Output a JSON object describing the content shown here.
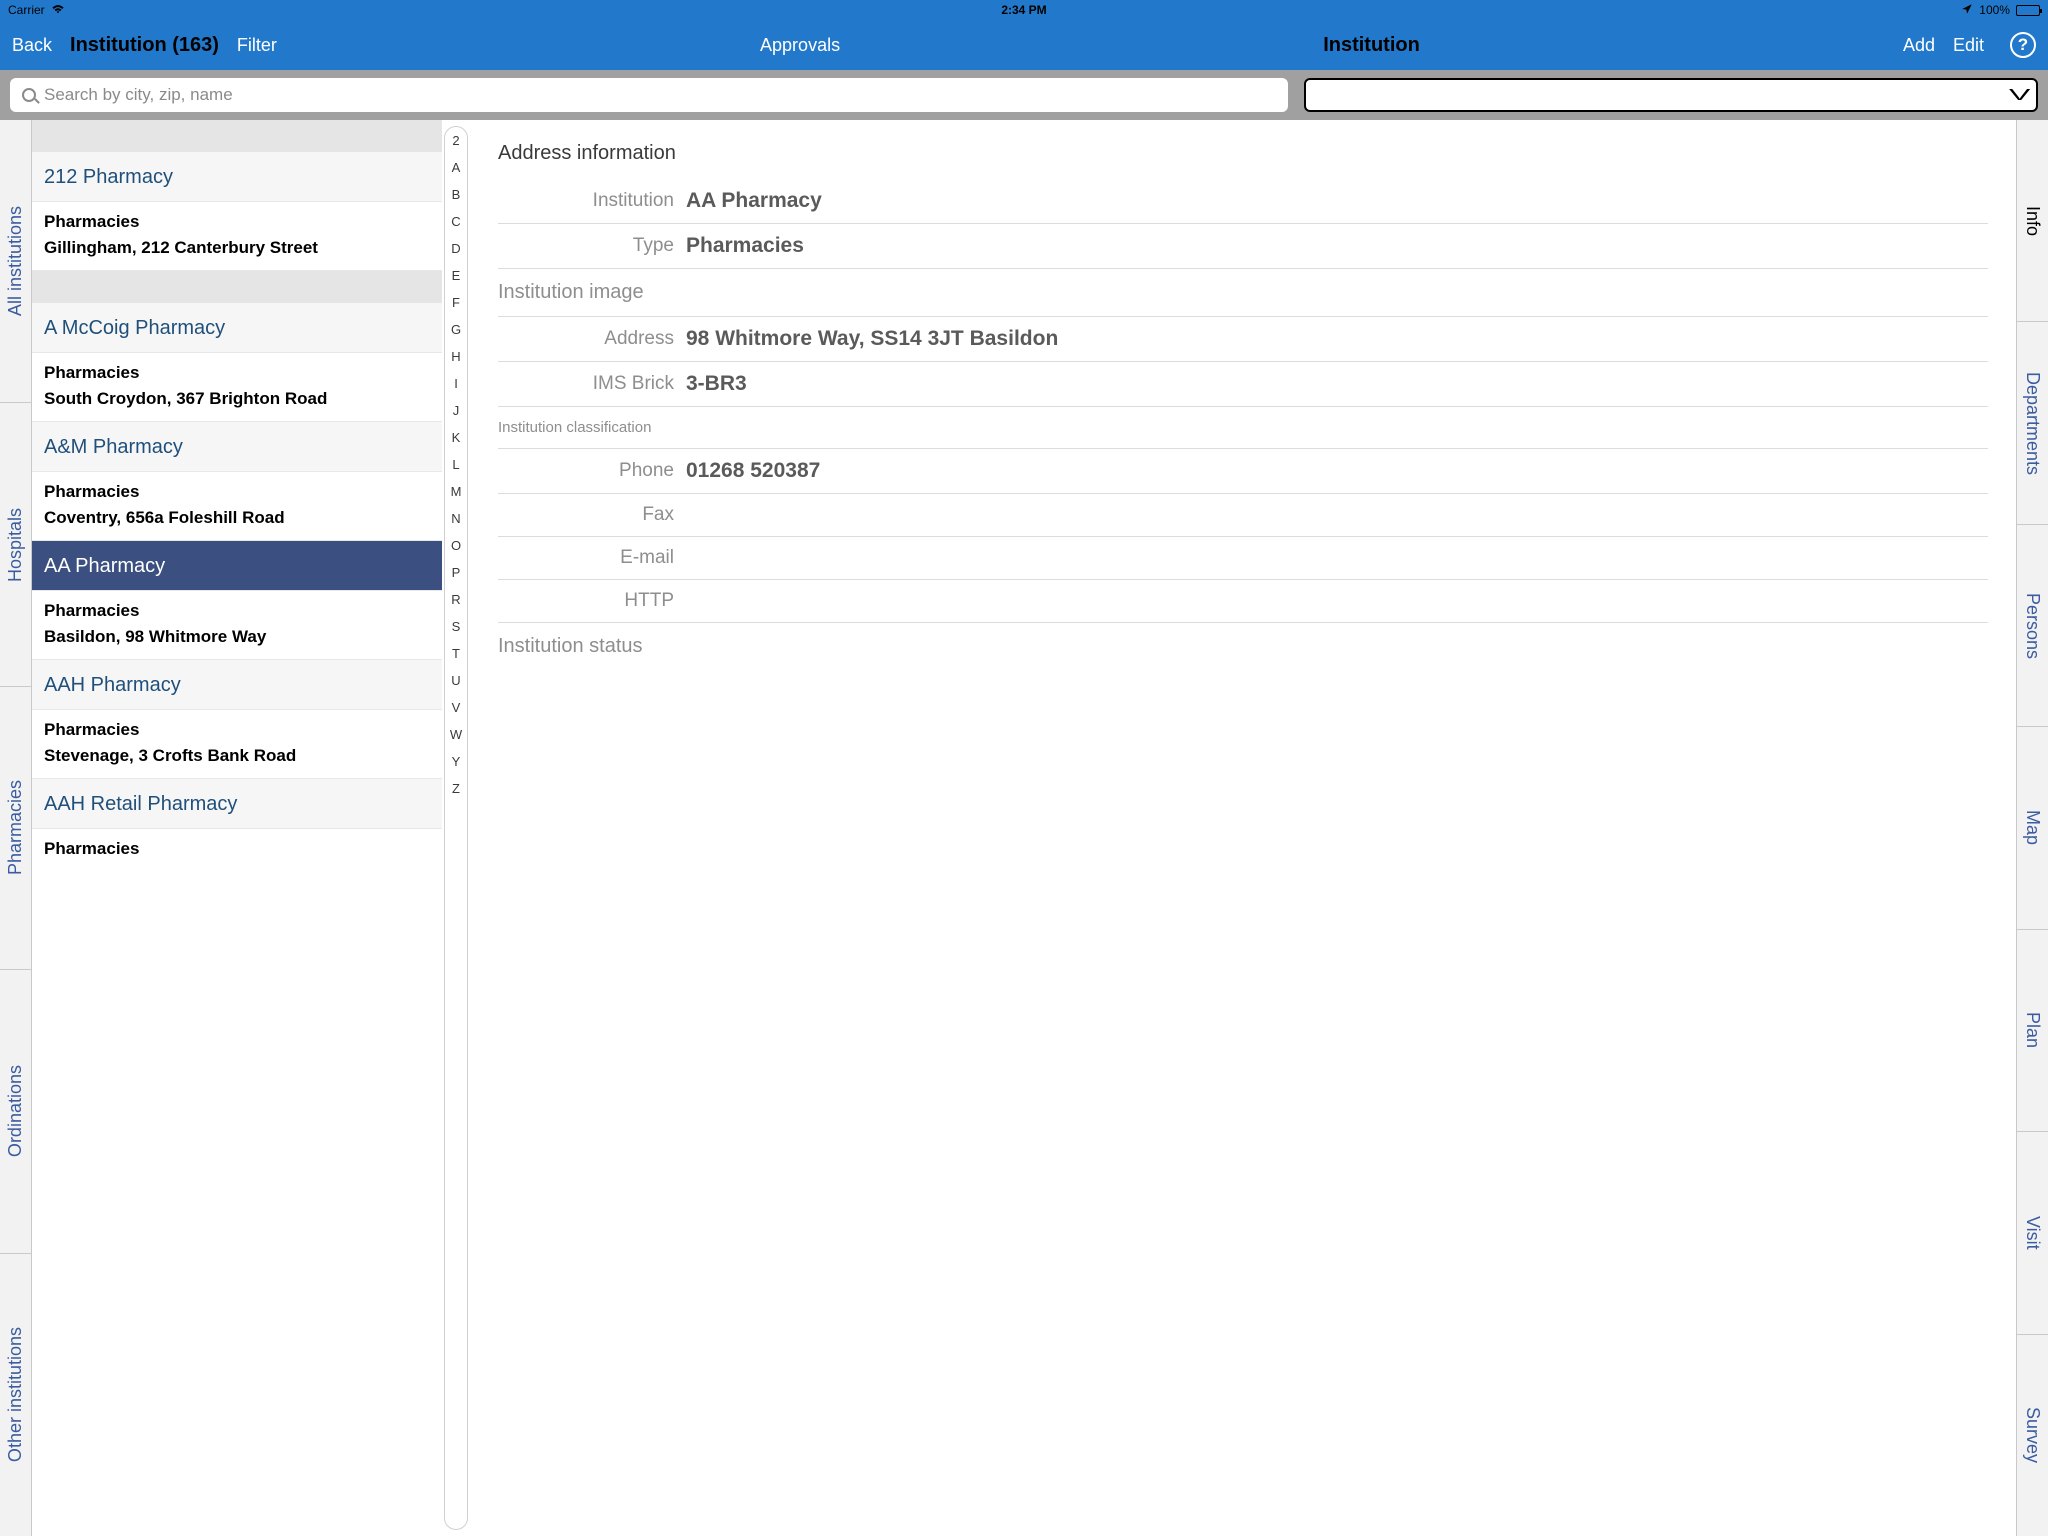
{
  "status": {
    "carrier": "Carrier",
    "time": "2:34 PM",
    "battery": "100%"
  },
  "nav": {
    "back": "Back",
    "title_left": "Institution (163)",
    "filter": "Filter",
    "approvals": "Approvals",
    "title_right": "Institution",
    "add": "Add",
    "edit": "Edit"
  },
  "search": {
    "placeholder": "Search by city, zip, name"
  },
  "left_tabs": [
    "All institutions",
    "Hospitals",
    "Pharmacies",
    "Ordinations",
    "Other institutions"
  ],
  "right_tabs": [
    "Info",
    "Departments",
    "Persons",
    "Map",
    "Plan",
    "Visit",
    "Survey"
  ],
  "index_letters": [
    "2",
    "A",
    "B",
    "C",
    "D",
    "E",
    "F",
    "G",
    "H",
    "I",
    "J",
    "K",
    "L",
    "M",
    "N",
    "O",
    "P",
    "R",
    "S",
    "T",
    "U",
    "V",
    "W",
    "Y",
    "Z"
  ],
  "list": [
    {
      "name": "212 Pharmacy",
      "type": "Pharmacies",
      "addr": "Gillingham, 212 Canterbury Street",
      "selected": false,
      "spacer_before": true
    },
    {
      "name": "A McCoig Pharmacy",
      "type": "Pharmacies",
      "addr": "South Croydon, 367 Brighton Road",
      "selected": false,
      "spacer_before": true
    },
    {
      "name": "A&M Pharmacy",
      "type": "Pharmacies",
      "addr": "Coventry, 656a Foleshill Road",
      "selected": false,
      "spacer_before": false
    },
    {
      "name": "AA Pharmacy",
      "type": "Pharmacies",
      "addr": "Basildon, 98 Whitmore Way",
      "selected": true,
      "spacer_before": false
    },
    {
      "name": "AAH Pharmacy",
      "type": "Pharmacies",
      "addr": "Stevenage, 3 Crofts Bank Road",
      "selected": false,
      "spacer_before": false
    },
    {
      "name": "AAH Retail Pharmacy",
      "type": "Pharmacies",
      "addr": "",
      "selected": false,
      "spacer_before": false
    }
  ],
  "detail": {
    "section1": "Address information",
    "fields1": {
      "institution_label": "Institution",
      "institution_value": "AA Pharmacy",
      "type_label": "Type",
      "type_value": "Pharmacies"
    },
    "image_header": "Institution image",
    "fields2": {
      "address_label": "Address",
      "address_value": "98 Whitmore Way, SS14 3JT Basildon",
      "ims_label": "IMS Brick",
      "ims_value": "3-BR3"
    },
    "class_header": "Institution classification",
    "fields3": {
      "phone_label": "Phone",
      "phone_value": "01268 520387",
      "fax_label": "Fax",
      "fax_value": "",
      "email_label": "E-mail",
      "email_value": "",
      "http_label": "HTTP",
      "http_value": ""
    },
    "status_header": "Institution status"
  }
}
